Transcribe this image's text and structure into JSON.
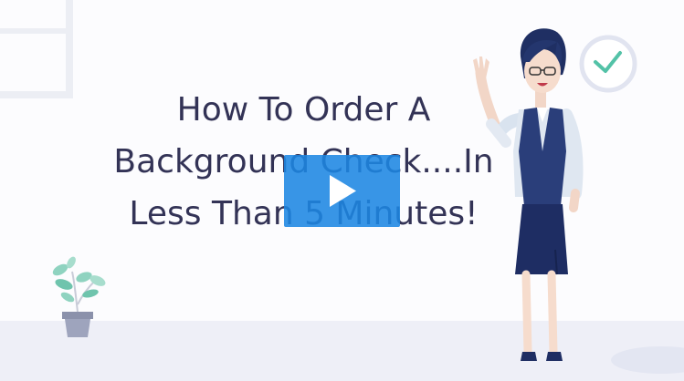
{
  "video": {
    "title_lines": [
      "How To Order A",
      "Background Check....In",
      "Less Than 5 Minutes!"
    ]
  },
  "icons": {
    "play": "play-icon",
    "clock": "clock-icon",
    "plant": "plant-icon"
  },
  "colors": {
    "title_text": "#333356",
    "play_button": "#1d86e2",
    "floor": "#eeeff7"
  }
}
